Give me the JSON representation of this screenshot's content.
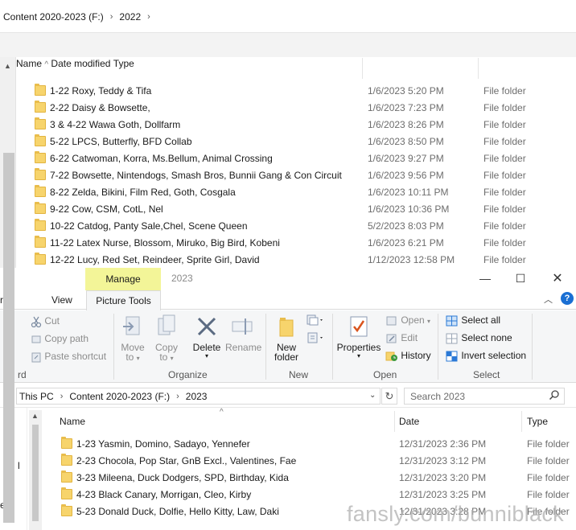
{
  "back_window": {
    "breadcrumb": [
      "Content 2020-2023 (F:)",
      "2022"
    ],
    "columns": {
      "name": "Name",
      "date": "Date modified",
      "type": "Type"
    },
    "rows": [
      {
        "name": "1-22 Roxy, Teddy & Tifa",
        "date": "1/6/2023 5:20 PM",
        "type": "File folder"
      },
      {
        "name": "2-22 Daisy & Bowsette,",
        "date": "1/6/2023 7:23 PM",
        "type": "File folder"
      },
      {
        "name": "3 & 4-22 Wawa Goth, Dollfarm",
        "date": "1/6/2023 8:26 PM",
        "type": "File folder"
      },
      {
        "name": "5-22 LPCS, Butterfly, BFD Collab",
        "date": "1/6/2023 8:50 PM",
        "type": "File folder"
      },
      {
        "name": "6-22 Catwoman, Korra, Ms.Bellum, Animal Crossing",
        "date": "1/6/2023 9:27 PM",
        "type": "File folder"
      },
      {
        "name": "7-22 Bowsette, Nintendogs, Smash Bros, Bunnii Gang & Con Circuit",
        "date": "1/6/2023 9:56 PM",
        "type": "File folder"
      },
      {
        "name": "8-22 Zelda, Bikini, Film Red, Goth, Cosgala",
        "date": "1/6/2023 10:11 PM",
        "type": "File folder"
      },
      {
        "name": "9-22 Cow, CSM, CotL, Nel",
        "date": "1/6/2023 10:36 PM",
        "type": "File folder"
      },
      {
        "name": "10-22 Catdog, Panty Sale,Chel, Scene Queen",
        "date": "5/2/2023 8:03 PM",
        "type": "File folder"
      },
      {
        "name": "11-22 Latex Nurse, Blossom, Miruko, Big Bird, Kobeni",
        "date": "1/6/2023 6:21 PM",
        "type": "File folder"
      },
      {
        "name": "12-22 Lucy, Red Set, Reindeer, Sprite Girl, David",
        "date": "1/12/2023 12:58 PM",
        "type": "File folder"
      }
    ]
  },
  "front_window": {
    "title": "2023",
    "manage_tab": "Manage",
    "tabs": {
      "share_fragment": "re",
      "view": "View",
      "picture_tools": "Picture Tools"
    },
    "ribbon": {
      "clipboard": {
        "cut": "Cut",
        "copy_path": "Copy path",
        "paste_shortcut": "Paste shortcut",
        "label_fragment": "rd"
      },
      "organize": {
        "move_to_1": "Move",
        "move_to_2": "to",
        "copy_to_1": "Copy",
        "copy_to_2": "to",
        "delete": "Delete",
        "rename": "Rename",
        "label": "Organize"
      },
      "new": {
        "new_folder_1": "New",
        "new_folder_2": "folder",
        "label": "New"
      },
      "open": {
        "properties": "Properties",
        "open": "Open",
        "edit": "Edit",
        "history": "History",
        "label": "Open"
      },
      "select": {
        "select_all": "Select all",
        "select_none": "Select none",
        "invert_selection": "Invert selection",
        "label": "Select"
      }
    },
    "address": [
      "This PC",
      "Content 2020-2023 (F:)",
      "2023"
    ],
    "search_placeholder": "Search 2023",
    "columns": {
      "name": "Name",
      "date": "Date",
      "type": "Type"
    },
    "nav_fragments": [
      "l",
      "es"
    ],
    "rows": [
      {
        "name": "1-23  Yasmin, Domino, Sadayo, Yennefer",
        "date": "12/31/2023 2:36 PM",
        "type": "File folder"
      },
      {
        "name": "2-23  Chocola, Pop Star, GnB Excl., Valentines, Fae",
        "date": "12/31/2023 3:12 PM",
        "type": "File folder"
      },
      {
        "name": "3-23  Mileena, Duck Dodgers, SPD, Birthday, Kida",
        "date": "12/31/2023 3:20 PM",
        "type": "File folder"
      },
      {
        "name": "4-23  Black Canary, Morrigan, Cleo, Kirby",
        "date": "12/31/2023 3:25 PM",
        "type": "File folder"
      },
      {
        "name": "5-23  Donald Duck, Dolfie, Hello Kitty, Law, Daki",
        "date": "12/31/2023 3:28 PM",
        "type": "File folder"
      }
    ]
  },
  "watermark": "fansly.com/bunniblack",
  "colors": {
    "manage_tab": "#f3f598",
    "folder": "#f7d46c",
    "help": "#1a6fd3",
    "select_icon": "#2b79d6"
  }
}
